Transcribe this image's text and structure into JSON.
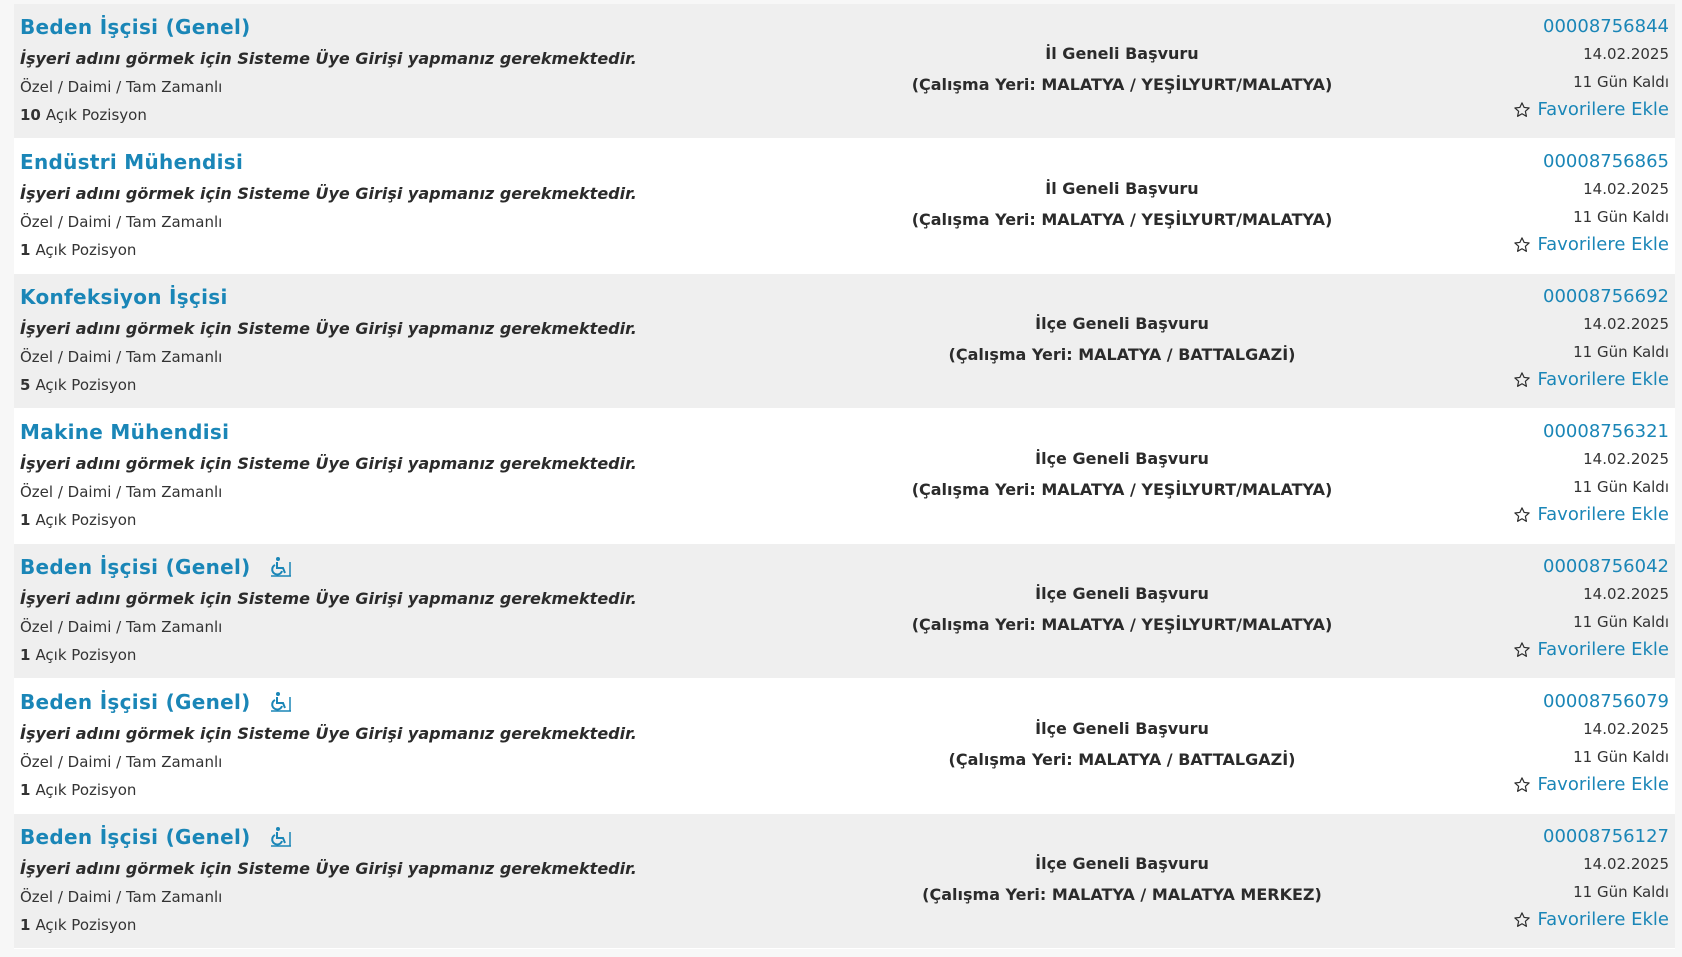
{
  "listings": [
    {
      "title": "Beden İşçisi (Genel)",
      "disabled_icon": false,
      "notice": "İşyeri adını görmek için Sisteme Üye Girişi yapmanız gerekmektedir.",
      "type": "Özel / Daimi / Tam Zamanlı",
      "positions_count": "10",
      "positions_label": "Açık Pozisyon",
      "scope": "İl Geneli Başvuru",
      "location": "(Çalışma Yeri: MALATYA / YEŞİLYURT/MALATYA)",
      "code": "00008756844",
      "date": "14.02.2025",
      "remaining": "11 Gün Kaldı",
      "favorite_label": "Favorilere Ekle"
    },
    {
      "title": "Endüstri Mühendisi",
      "disabled_icon": false,
      "notice": "İşyeri adını görmek için Sisteme Üye Girişi yapmanız gerekmektedir.",
      "type": "Özel / Daimi / Tam Zamanlı",
      "positions_count": "1",
      "positions_label": "Açık Pozisyon",
      "scope": "İl Geneli Başvuru",
      "location": "(Çalışma Yeri: MALATYA / YEŞİLYURT/MALATYA)",
      "code": "00008756865",
      "date": "14.02.2025",
      "remaining": "11 Gün Kaldı",
      "favorite_label": "Favorilere Ekle"
    },
    {
      "title": "Konfeksiyon İşçisi",
      "disabled_icon": false,
      "notice": "İşyeri adını görmek için Sisteme Üye Girişi yapmanız gerekmektedir.",
      "type": "Özel / Daimi / Tam Zamanlı",
      "positions_count": "5",
      "positions_label": "Açık Pozisyon",
      "scope": "İlçe Geneli Başvuru",
      "location": "(Çalışma Yeri: MALATYA / BATTALGAZİ)",
      "code": "00008756692",
      "date": "14.02.2025",
      "remaining": "11 Gün Kaldı",
      "favorite_label": "Favorilere Ekle"
    },
    {
      "title": "Makine Mühendisi",
      "disabled_icon": false,
      "notice": "İşyeri adını görmek için Sisteme Üye Girişi yapmanız gerekmektedir.",
      "type": "Özel / Daimi / Tam Zamanlı",
      "positions_count": "1",
      "positions_label": "Açık Pozisyon",
      "scope": "İlçe Geneli Başvuru",
      "location": "(Çalışma Yeri: MALATYA / YEŞİLYURT/MALATYA)",
      "code": "00008756321",
      "date": "14.02.2025",
      "remaining": "11 Gün Kaldı",
      "favorite_label": "Favorilere Ekle"
    },
    {
      "title": "Beden İşçisi (Genel)",
      "disabled_icon": true,
      "notice": "İşyeri adını görmek için Sisteme Üye Girişi yapmanız gerekmektedir.",
      "type": "Özel / Daimi / Tam Zamanlı",
      "positions_count": "1",
      "positions_label": "Açık Pozisyon",
      "scope": "İlçe Geneli Başvuru",
      "location": "(Çalışma Yeri: MALATYA / YEŞİLYURT/MALATYA)",
      "code": "00008756042",
      "date": "14.02.2025",
      "remaining": "11 Gün Kaldı",
      "favorite_label": "Favorilere Ekle"
    },
    {
      "title": "Beden İşçisi (Genel)",
      "disabled_icon": true,
      "notice": "İşyeri adını görmek için Sisteme Üye Girişi yapmanız gerekmektedir.",
      "type": "Özel / Daimi / Tam Zamanlı",
      "positions_count": "1",
      "positions_label": "Açık Pozisyon",
      "scope": "İlçe Geneli Başvuru",
      "location": "(Çalışma Yeri: MALATYA / BATTALGAZİ)",
      "code": "00008756079",
      "date": "14.02.2025",
      "remaining": "11 Gün Kaldı",
      "favorite_label": "Favorilere Ekle"
    },
    {
      "title": "Beden İşçisi (Genel)",
      "disabled_icon": true,
      "notice": "İşyeri adını görmek için Sisteme Üye Girişi yapmanız gerekmektedir.",
      "type": "Özel / Daimi / Tam Zamanlı",
      "positions_count": "1",
      "positions_label": "Açık Pozisyon",
      "scope": "İlçe Geneli Başvuru",
      "location": "(Çalışma Yeri: MALATYA / MALATYA MERKEZ)",
      "code": "00008756127",
      "date": "14.02.2025",
      "remaining": "11 Gün Kaldı",
      "favorite_label": "Favorilere Ekle"
    }
  ],
  "colors": {
    "link": "#1a86b7",
    "row_alt": "#efefef",
    "row": "#ffffff",
    "text": "#2b2b2b"
  },
  "icons": {
    "favorite": "star-outline-icon",
    "disabled_access": "wheelchair-icon"
  }
}
